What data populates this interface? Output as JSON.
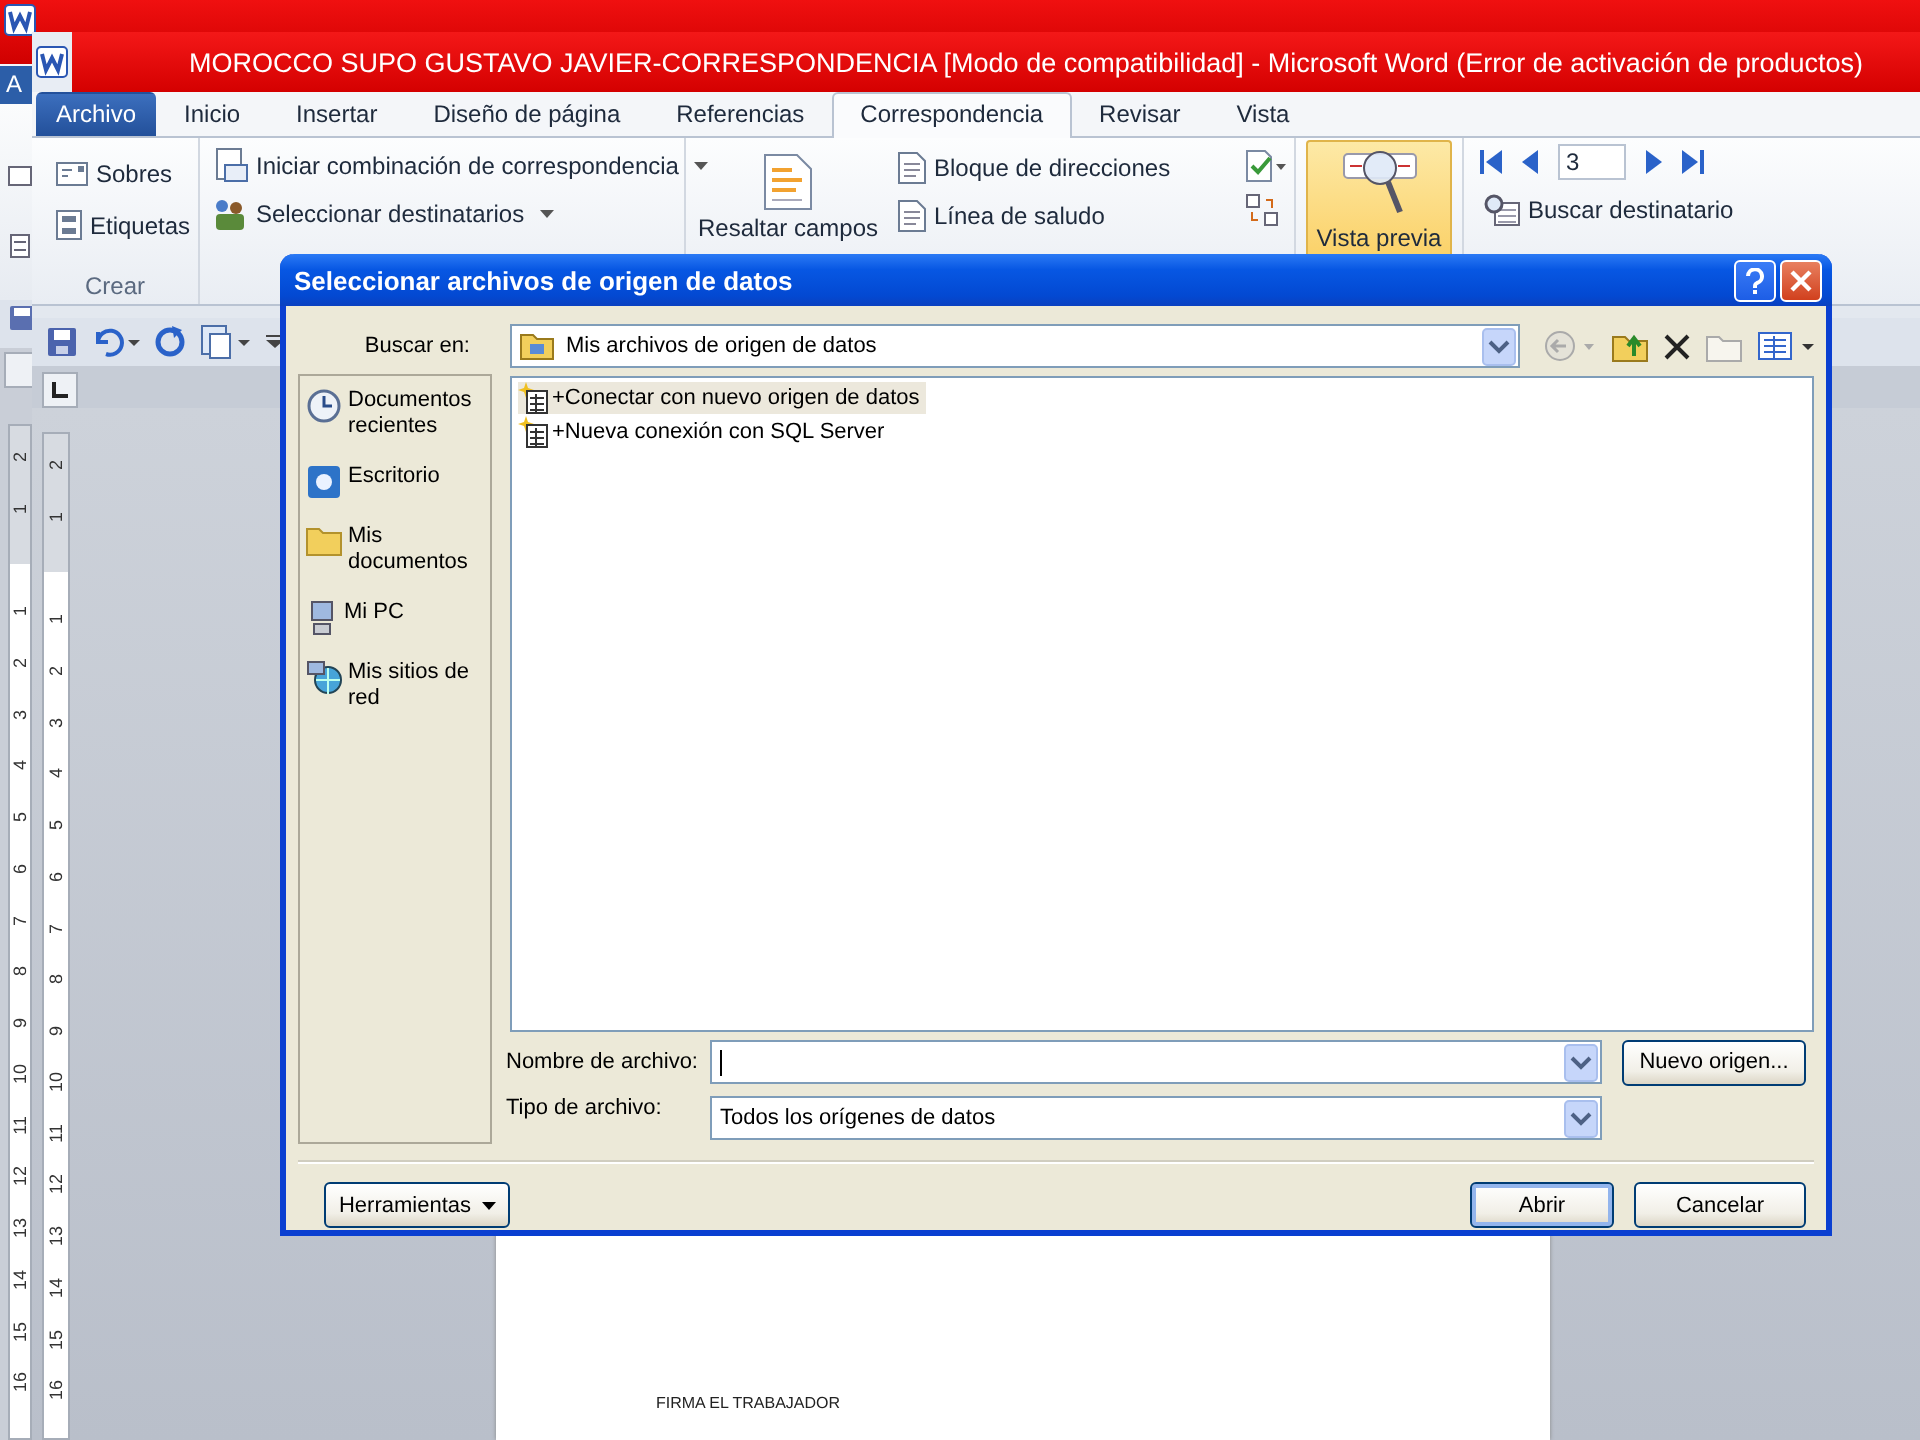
{
  "back_window": {
    "tab": "A",
    "ruler": [
      "2",
      "1",
      "1",
      "2",
      "3",
      "4",
      "5",
      "6",
      "7",
      "8",
      "9",
      "10",
      "11",
      "12",
      "13",
      "14",
      "15",
      "16"
    ]
  },
  "word": {
    "title": "MOROCCO SUPO GUSTAVO JAVIER-CORRESPONDENCIA [Modo de compatibilidad]  -  Microsoft Word (Error de activación de productos)",
    "tabs": [
      {
        "label": "Archivo",
        "kind": "file",
        "selected": false
      },
      {
        "label": "Inicio",
        "kind": "tab",
        "selected": false
      },
      {
        "label": "Insertar",
        "kind": "tab",
        "selected": false
      },
      {
        "label": "Diseño de página",
        "kind": "tab",
        "selected": false
      },
      {
        "label": "Referencias",
        "kind": "tab",
        "selected": false
      },
      {
        "label": "Correspondencia",
        "kind": "tab",
        "selected": true
      },
      {
        "label": "Revisar",
        "kind": "tab",
        "selected": false
      },
      {
        "label": "Vista",
        "kind": "tab",
        "selected": false
      }
    ],
    "ribbon": {
      "crear": {
        "label": "Crear",
        "buttons": [
          "Sobres",
          "Etiquetas"
        ]
      },
      "iniciar": [
        {
          "label": "Iniciar combinación de correspondencia",
          "dropdown": true
        },
        {
          "label": "Seleccionar destinatarios",
          "dropdown": true
        }
      ],
      "escribir": {
        "big_button": "Resaltar campos",
        "buttons": [
          "Bloque de direcciones",
          "Línea de saludo"
        ]
      },
      "preview": {
        "label": "Vista previa",
        "selected": true
      },
      "navigation": {
        "record": "3",
        "find": "Buscar destinatario"
      }
    },
    "ruler": [
      "2",
      "1",
      "1",
      "2",
      "3",
      "4",
      "5",
      "6",
      "7",
      "8",
      "9",
      "10",
      "11",
      "12",
      "13",
      "14",
      "15",
      "16"
    ],
    "document": {
      "text": "FIRMA EL TRABAJADOR"
    }
  },
  "dialog": {
    "title": "Seleccionar archivos de origen de datos",
    "look_in": {
      "label": "Buscar en:",
      "value": "Mis archivos de origen de datos"
    },
    "places": [
      {
        "label": "Documentos recientes",
        "kind": "recent"
      },
      {
        "label": "Escritorio",
        "kind": "desktop"
      },
      {
        "label": "Mis documentos",
        "kind": "documents"
      },
      {
        "label": "Mi PC",
        "kind": "computer"
      },
      {
        "label": "Mis sitios de red",
        "kind": "network"
      }
    ],
    "files": [
      {
        "name": "+Conectar con nuevo origen de datos",
        "selected": true
      },
      {
        "name": "+Nueva conexión con SQL Server",
        "selected": false
      }
    ],
    "file_name": {
      "label": "Nombre de archivo:"
    },
    "new_source_button": "Nuevo origen...",
    "file_type": {
      "label": "Tipo de archivo:",
      "value": "Todos los orígenes de datos"
    },
    "tools_button": "Herramientas",
    "buttons": [
      {
        "label": "Abrir",
        "default": true
      },
      {
        "label": "Cancelar",
        "default": false
      }
    ]
  }
}
